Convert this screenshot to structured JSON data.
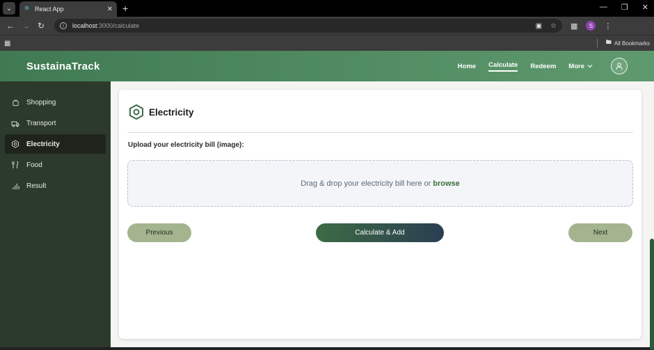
{
  "browser": {
    "tab_title": "React App",
    "url_host": "localhost",
    "url_path": ":3000/calculate",
    "profile_initial": "S",
    "bookmarks_label": "All Bookmarks"
  },
  "header": {
    "brand": "SustainaTrack",
    "nav": [
      "Home",
      "Calculate",
      "Redeem",
      "More"
    ],
    "active_nav": "Calculate"
  },
  "sidebar": {
    "items": [
      {
        "label": "Shopping",
        "icon": "shopping-bag-icon"
      },
      {
        "label": "Transport",
        "icon": "truck-icon"
      },
      {
        "label": "Electricity",
        "icon": "hexagon-icon",
        "active": true
      },
      {
        "label": "Food",
        "icon": "utensils-icon"
      },
      {
        "label": "Result",
        "icon": "bar-chart-icon"
      }
    ]
  },
  "main": {
    "title": "Electricity",
    "upload_label": "Upload your electricity bill (image):",
    "dropzone_text": "Drag & drop your electricity bill here or",
    "browse_label": "browse",
    "prev_label": "Previous",
    "calc_label": "Calculate & Add",
    "next_label": "Next"
  },
  "colors": {
    "header_start": "#3f7a53",
    "header_end": "#5f9a6e",
    "sidebar_bg": "#2c3a2b",
    "button_green": "#a3b48f"
  }
}
